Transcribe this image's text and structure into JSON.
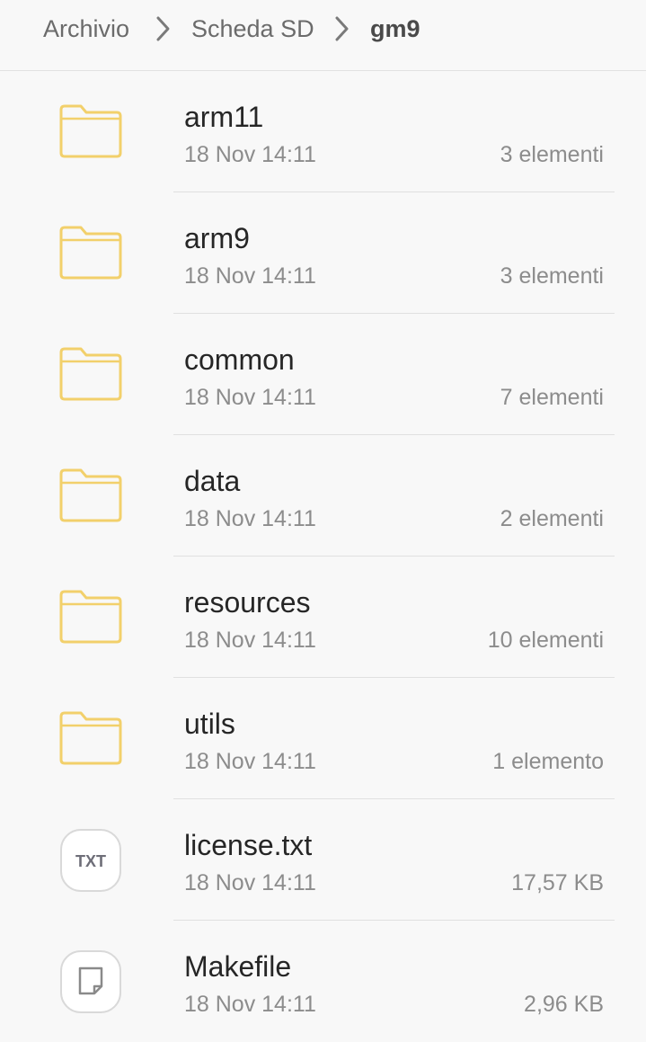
{
  "breadcrumb": {
    "items": [
      "Archivio",
      "Scheda SD",
      "gm9"
    ]
  },
  "colors": {
    "folder": "#f2d06b",
    "file_border": "#d9d9d9",
    "text_primary": "#262626",
    "text_secondary": "#8c8c8c"
  },
  "files": [
    {
      "name": "arm11",
      "date": "18 Nov 14:11",
      "meta": "3 elementi",
      "icon": "folder-icon"
    },
    {
      "name": "arm9",
      "date": "18 Nov 14:11",
      "meta": "3 elementi",
      "icon": "folder-icon"
    },
    {
      "name": "common",
      "date": "18 Nov 14:11",
      "meta": "7 elementi",
      "icon": "folder-icon"
    },
    {
      "name": "data",
      "date": "18 Nov 14:11",
      "meta": "2 elementi",
      "icon": "folder-icon"
    },
    {
      "name": "resources",
      "date": "18 Nov 14:11",
      "meta": "10 elementi",
      "icon": "folder-icon"
    },
    {
      "name": "utils",
      "date": "18 Nov 14:11",
      "meta": "1 elemento",
      "icon": "folder-icon"
    },
    {
      "name": "license.txt",
      "date": "18 Nov 14:11",
      "meta": "17,57 KB",
      "icon": "txt-file-icon",
      "badge": "TXT"
    },
    {
      "name": "Makefile",
      "date": "18 Nov 14:11",
      "meta": "2,96 KB",
      "icon": "generic-file-icon"
    }
  ]
}
